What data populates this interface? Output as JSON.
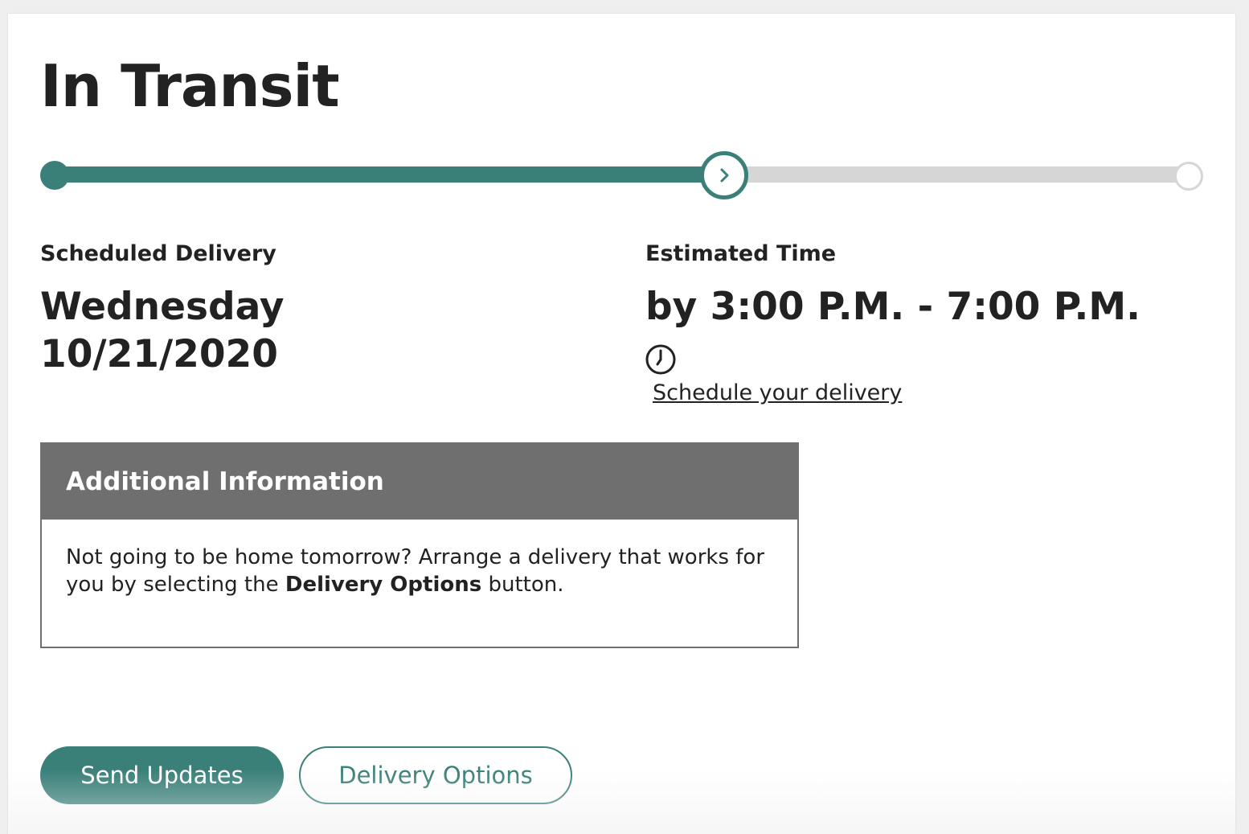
{
  "header": {
    "title": "In Transit"
  },
  "progress": {
    "fraction_complete": 0.59,
    "current_icon": "chevron-right-icon",
    "colors": {
      "fill": "#3a8079",
      "track": "#d6d6d6"
    }
  },
  "scheduled_delivery": {
    "label": "Scheduled Delivery",
    "day": "Wednesday",
    "date": "10/21/2020"
  },
  "estimated_time": {
    "label": "Estimated Time",
    "window": "by 3:00 P.M. - 7:00 P.M.",
    "icon": "clock-icon",
    "link_text": "Schedule your delivery"
  },
  "additional_info": {
    "heading": "Additional Information",
    "text_before": "Not going to be home tomorrow? Arrange a delivery that works for you by selecting the ",
    "text_bold": "Delivery Options",
    "text_after": " button."
  },
  "actions": {
    "send_updates_label": "Send Updates",
    "delivery_options_label": "Delivery Options"
  }
}
